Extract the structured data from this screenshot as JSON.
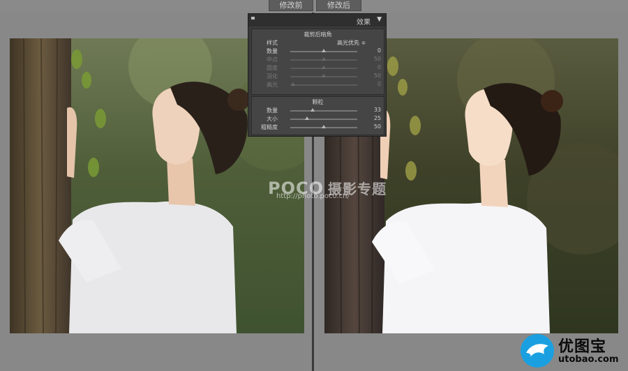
{
  "tabs": {
    "before": "修改前",
    "after": "修改后"
  },
  "panel": {
    "title": "效果",
    "toggle": "▼",
    "vignette": {
      "title": "裁剪后暗角",
      "style_label": "样式",
      "style_value": "高光优先 ≑",
      "sliders": [
        {
          "label": "数量",
          "value": "0",
          "dim": false,
          "pos": 0.5
        },
        {
          "label": "中点",
          "value": "50",
          "dim": true,
          "pos": 0.5
        },
        {
          "label": "圆度",
          "value": "0",
          "dim": true,
          "pos": 0.5
        },
        {
          "label": "羽化",
          "value": "50",
          "dim": true,
          "pos": 0.5
        },
        {
          "label": "高光",
          "value": "0",
          "dim": true,
          "pos": 0.04
        }
      ]
    },
    "grain": {
      "title": "颗粒",
      "sliders": [
        {
          "label": "数量",
          "value": "33",
          "dim": false,
          "pos": 0.33
        },
        {
          "label": "大小",
          "value": "25",
          "dim": false,
          "pos": 0.25
        },
        {
          "label": "粗糙度",
          "value": "50",
          "dim": false,
          "pos": 0.5
        }
      ]
    }
  },
  "watermark": {
    "brand": "POCO",
    "brand_cn": "摄影专题",
    "url": "http://photo.poco.cn/"
  },
  "logo": {
    "name": "优图宝",
    "domain": "utobao.com",
    "icon": "bird-icon"
  },
  "colors": {
    "panel_bg": "#3a3a3a",
    "logo_blue": "#1aa0e0"
  }
}
